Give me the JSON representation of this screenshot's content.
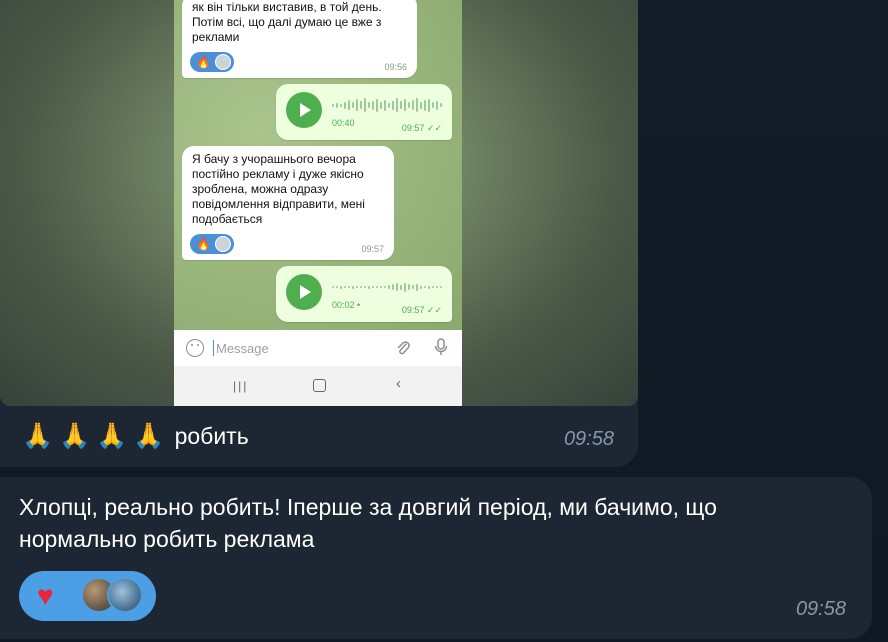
{
  "photo_message": {
    "caption_emoji": [
      "🙏",
      "🙏",
      "🙏",
      "🙏"
    ],
    "caption_text": "робить",
    "time": "09:58",
    "screenshot": {
      "messages": [
        {
          "direction": "incoming",
          "text_lines": [
            "як він тільки виставив, в той день.",
            "Потім всі, що далі думаю це вже  з",
            "реклами"
          ],
          "reaction": "🔥",
          "time": "09:56"
        },
        {
          "direction": "outgoing",
          "type": "voice",
          "duration": "00:40",
          "time": "09:57"
        },
        {
          "direction": "incoming",
          "text_lines": [
            "Я бачу з учорашнього вечора",
            "постійно рекламу і дуже якісно",
            "зроблена, можна одразу",
            "повідомлення відправити, мені",
            "подобається"
          ],
          "reaction": "🔥",
          "time": "09:57"
        },
        {
          "direction": "outgoing",
          "type": "voice",
          "duration": "00:02 •",
          "time": "09:57"
        }
      ],
      "input_placeholder": "Message",
      "icons": {
        "emoji": "smile-icon",
        "attach": "paperclip-icon",
        "mic": "microphone-icon"
      },
      "nav_recent": "|||",
      "nav_back": "‹"
    }
  },
  "text_message": {
    "lines": [
      "Хлопці, реально робить! Іперше за довгий період, ми бачимо, що",
      "нормально робить реклама"
    ],
    "reaction": "♥",
    "time": "09:58"
  },
  "colors": {
    "chat_background": "#0f1823",
    "bubble": "#1c2733",
    "reaction_accent": "#4c9fe4",
    "heart": "#e8253f",
    "time": "#8797a6",
    "voice_green": "#4fae4e"
  }
}
